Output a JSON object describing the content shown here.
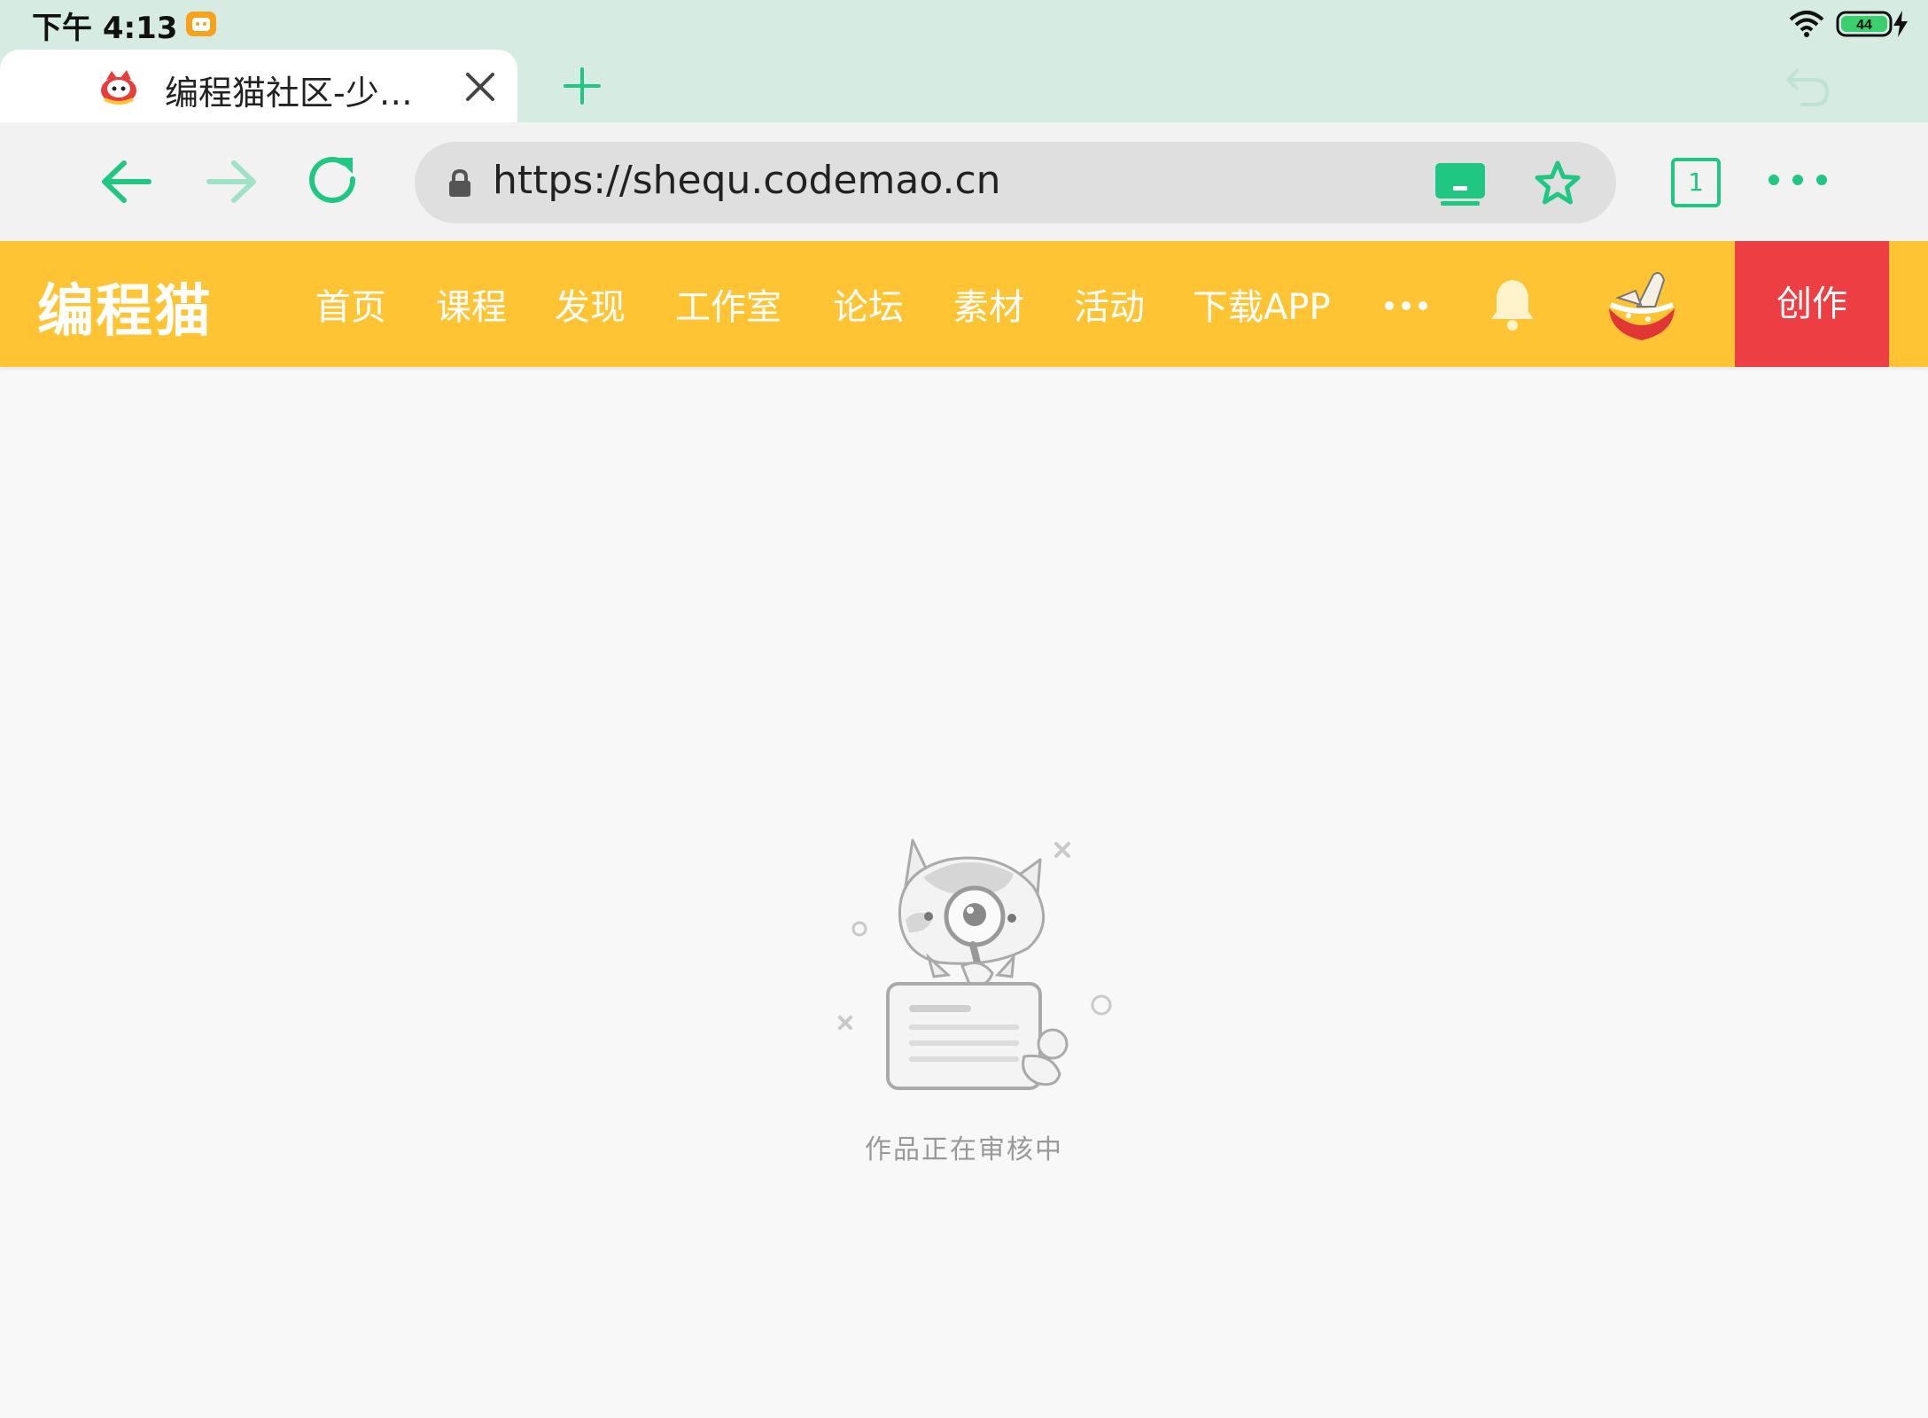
{
  "status_bar": {
    "time": "下午 4:13",
    "battery_level": "44",
    "icons": [
      "app-notification-icon",
      "wifi-icon",
      "battery-icon",
      "charging-icon"
    ]
  },
  "browser": {
    "tab": {
      "title": "编程猫社区-少…",
      "favicon": "codemao-favicon"
    },
    "url": "https://shequ.codemao.cn",
    "tabs_count": "1",
    "accent_color": "#1fc783"
  },
  "site": {
    "logo": "编程猫",
    "nav": [
      "首页",
      "课程",
      "发现",
      "工作室",
      "论坛",
      "素材",
      "活动",
      "下载APP"
    ],
    "create_label": "创作",
    "header_color": "#fec433",
    "create_color": "#ed3e43"
  },
  "main": {
    "empty_message": "作品正在审核中"
  }
}
